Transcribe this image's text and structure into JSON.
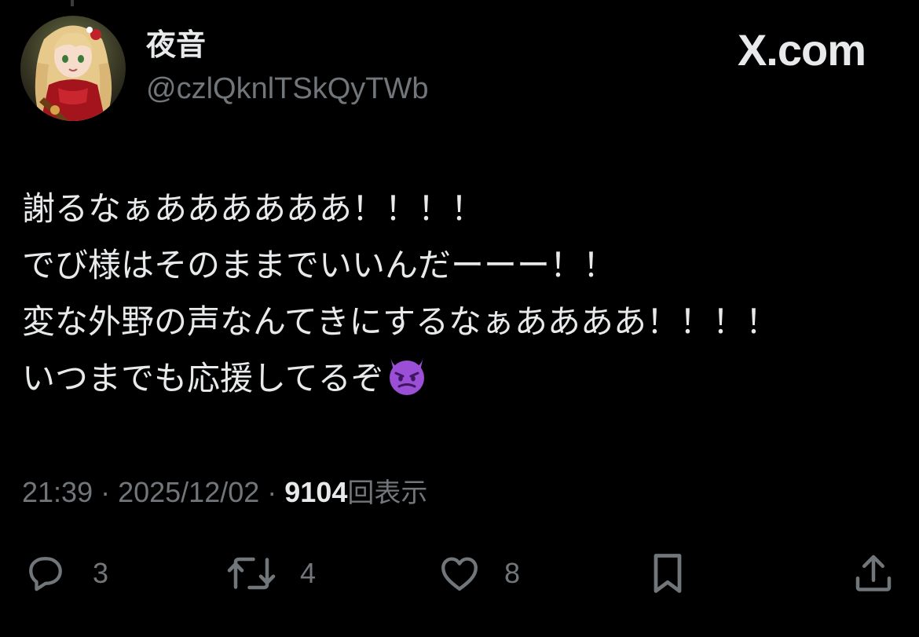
{
  "author": {
    "display_name": "夜音",
    "handle": "@czlQknlTSkQyTWb"
  },
  "brand": "X.com",
  "tweet": {
    "lines": [
      "謝るなぁああああああ！！！！",
      "でび様はそのままでいいんだーーー！！",
      "変な外野の声なんてきにするなぁああああ！！！！",
      "いつまでも応援してるぞ"
    ],
    "trailing_emoji": "smiling-face-with-horns-emoji"
  },
  "meta": {
    "time": "21:39",
    "separator": " · ",
    "date": "2025/12/02",
    "views_count": "9104",
    "views_label": "回表示"
  },
  "actions": {
    "replies": "3",
    "reposts": "4",
    "likes": "8"
  },
  "colors": {
    "background": "#000000",
    "primary_text": "#e7e9ea",
    "secondary_text": "#71767b",
    "emoji_purple": "#9b4fd6"
  },
  "icons": [
    "reply-icon",
    "repost-icon",
    "like-icon",
    "bookmark-icon",
    "share-icon"
  ]
}
